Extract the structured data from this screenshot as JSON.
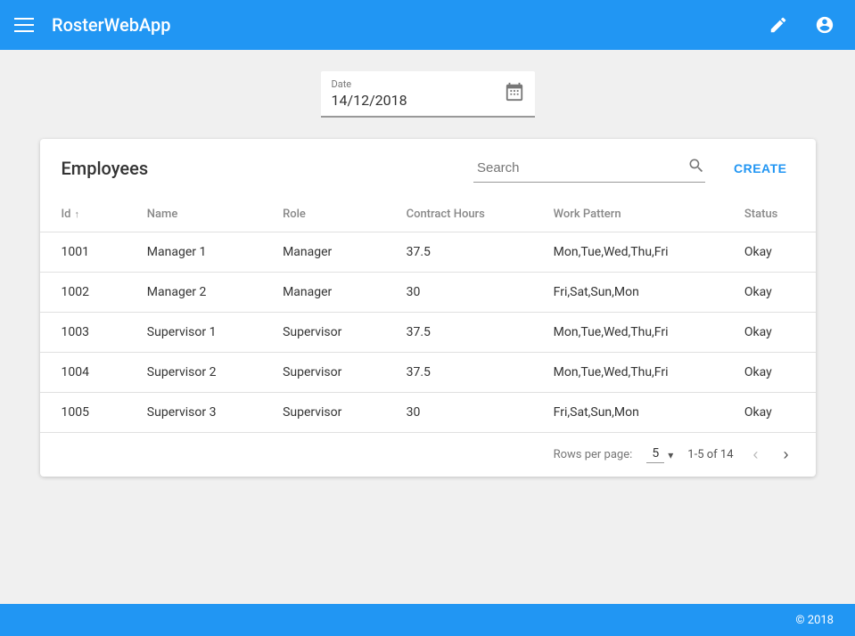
{
  "app": {
    "title": "RosterWebApp",
    "footer_copyright": "© 2018"
  },
  "topnav": {
    "menu_icon_label": "menu",
    "pencil_icon_label": "edit",
    "user_icon_label": "user"
  },
  "date_field": {
    "label": "Date",
    "value": "14/12/2018",
    "placeholder": "14/12/2018"
  },
  "table": {
    "title": "Employees",
    "create_label": "CREATE",
    "search_placeholder": "Search",
    "columns": [
      {
        "key": "id",
        "label": "Id",
        "sortable": true
      },
      {
        "key": "name",
        "label": "Name",
        "sortable": false
      },
      {
        "key": "role",
        "label": "Role",
        "sortable": false
      },
      {
        "key": "contract_hours",
        "label": "Contract Hours",
        "sortable": false
      },
      {
        "key": "work_pattern",
        "label": "Work Pattern",
        "sortable": false
      },
      {
        "key": "status",
        "label": "Status",
        "sortable": false
      }
    ],
    "rows": [
      {
        "id": "1001",
        "name": "Manager 1",
        "role": "Manager",
        "contract_hours": "37.5",
        "work_pattern": "Mon,Tue,Wed,Thu,Fri",
        "status": "Okay"
      },
      {
        "id": "1002",
        "name": "Manager 2",
        "role": "Manager",
        "contract_hours": "30",
        "work_pattern": "Fri,Sat,Sun,Mon",
        "status": "Okay"
      },
      {
        "id": "1003",
        "name": "Supervisor 1",
        "role": "Supervisor",
        "contract_hours": "37.5",
        "work_pattern": "Mon,Tue,Wed,Thu,Fri",
        "status": "Okay"
      },
      {
        "id": "1004",
        "name": "Supervisor 2",
        "role": "Supervisor",
        "contract_hours": "37.5",
        "work_pattern": "Mon,Tue,Wed,Thu,Fri",
        "status": "Okay"
      },
      {
        "id": "1005",
        "name": "Supervisor 3",
        "role": "Supervisor",
        "contract_hours": "30",
        "work_pattern": "Fri,Sat,Sun,Mon",
        "status": "Okay"
      }
    ],
    "pagination": {
      "rows_per_page_label": "Rows per page:",
      "rows_per_page_value": "5",
      "page_info": "1-5 of 14"
    }
  }
}
